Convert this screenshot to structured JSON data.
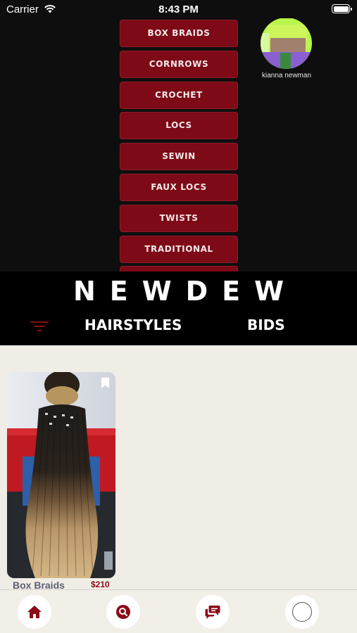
{
  "status_bar": {
    "carrier": "Carrier",
    "time": "8:43 PM"
  },
  "categories": [
    {
      "label": "BOX BRAIDS"
    },
    {
      "label": "CORNROWS"
    },
    {
      "label": "CROCHET"
    },
    {
      "label": "LOCS"
    },
    {
      "label": "SEWIN"
    },
    {
      "label": "FAUX LOCS"
    },
    {
      "label": "TWISTS"
    },
    {
      "label": "TRADITIONAL"
    },
    {
      "label": ""
    }
  ],
  "profile": {
    "name": "kianna newman"
  },
  "header": {
    "brand": "NEWDEW",
    "tabs": [
      "HAIRSTYLES",
      "BIDS"
    ]
  },
  "listings": [
    {
      "title": "Box Braids",
      "price": "$210"
    }
  ],
  "bottom_nav": [
    "home-icon",
    "search-icon",
    "chat-icon",
    "profile-icon"
  ],
  "colors": {
    "accent": "#7d0a16",
    "brand_bg": "#000000",
    "content_bg": "#efede6"
  }
}
